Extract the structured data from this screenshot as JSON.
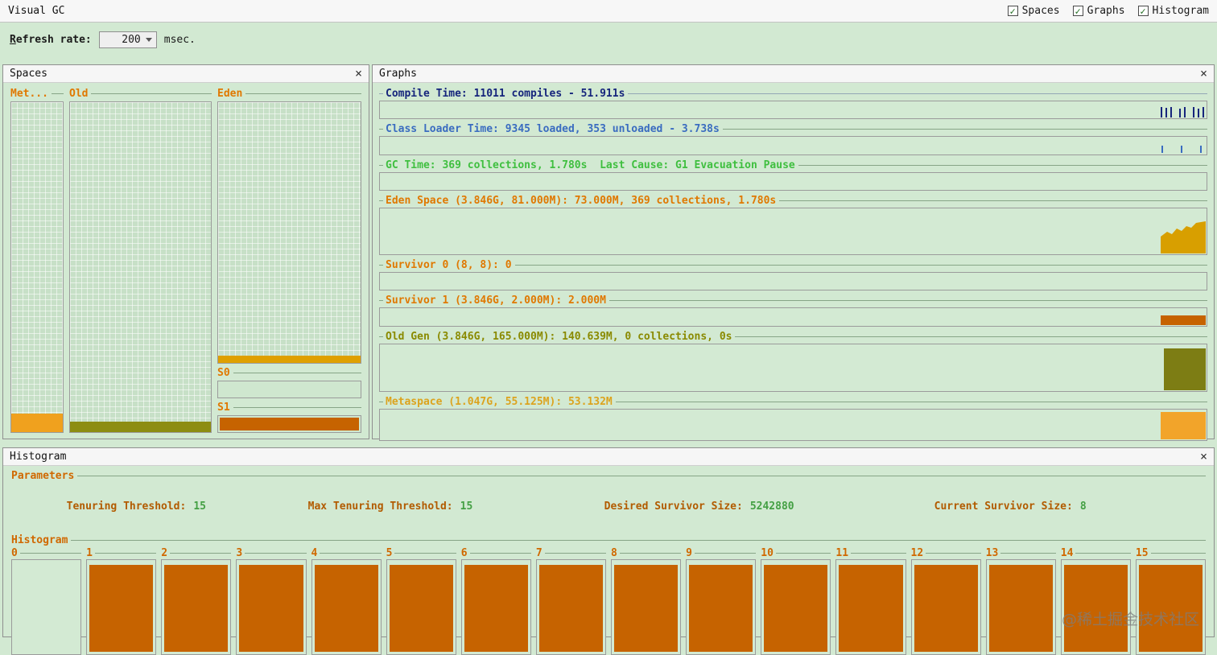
{
  "icons": {
    "close": "×",
    "check": "✓"
  },
  "topbar": {
    "title": "Visual GC",
    "checkboxes": [
      {
        "label": "Spaces",
        "checked": true
      },
      {
        "label": "Graphs",
        "checked": true
      },
      {
        "label": "Histogram",
        "checked": true
      }
    ]
  },
  "refresh": {
    "label": "Refresh rate:",
    "value": "200",
    "unit": "msec."
  },
  "spaces": {
    "title": "Spaces",
    "metaspace_label": "Met...",
    "old_label": "Old",
    "eden_label": "Eden",
    "s0_label": "S0",
    "s1_label": "S1"
  },
  "graphs": {
    "title": "Graphs",
    "rows": [
      {
        "id": "compile-time",
        "label": "Compile Time: 11011 compiles - 51.911s"
      },
      {
        "id": "class-loader",
        "label": "Class Loader Time: 9345 loaded, 353 unloaded - 3.738s"
      },
      {
        "id": "gc-time",
        "label": "GC Time: 369 collections, 1.780s  Last Cause: G1 Evacuation Pause"
      },
      {
        "id": "eden-space",
        "label": "Eden Space (3.846G, 81.000M): 73.000M, 369 collections, 1.780s"
      },
      {
        "id": "survivor-0",
        "label": "Survivor 0 (8, 8): 0"
      },
      {
        "id": "survivor-1",
        "label": "Survivor 1 (3.846G, 2.000M): 2.000M"
      },
      {
        "id": "old-gen",
        "label": "Old Gen (3.846G, 165.000M): 140.639M, 0 collections, 0s"
      },
      {
        "id": "metaspace",
        "label": "Metaspace (1.047G, 55.125M): 53.132M"
      }
    ]
  },
  "histogram": {
    "title": "Histogram",
    "parameters": {
      "group_label": "Parameters",
      "items": [
        {
          "label": "Tenuring Threshold:",
          "value": "15"
        },
        {
          "label": "Max Tenuring Threshold:",
          "value": "15"
        },
        {
          "label": "Desired Survivor Size:",
          "value": "5242880"
        },
        {
          "label": "Current Survivor Size:",
          "value": "8"
        }
      ]
    },
    "bars": {
      "group_label": "Histogram",
      "items": [
        {
          "label": "0",
          "filled": false
        },
        {
          "label": "1",
          "filled": true
        },
        {
          "label": "2",
          "filled": true
        },
        {
          "label": "3",
          "filled": true
        },
        {
          "label": "4",
          "filled": true
        },
        {
          "label": "5",
          "filled": true
        },
        {
          "label": "6",
          "filled": true
        },
        {
          "label": "7",
          "filled": true
        },
        {
          "label": "8",
          "filled": true
        },
        {
          "label": "9",
          "filled": true
        },
        {
          "label": "10",
          "filled": true
        },
        {
          "label": "11",
          "filled": true
        },
        {
          "label": "12",
          "filled": true
        },
        {
          "label": "13",
          "filled": true
        },
        {
          "label": "14",
          "filled": true
        },
        {
          "label": "15",
          "filled": true
        }
      ]
    }
  },
  "colors": {
    "background_green": "#d2e9d2",
    "compile_navy": "#16257c",
    "classloader_blue": "#3a6cc0",
    "gc_green": "#3fbf3f",
    "eden_orange": "#e07800",
    "oldgen_olive": "#8a8a00",
    "metaspace_amber": "#dca31e",
    "survivor_fill": "#c66300",
    "histogram_fill": "#c66300"
  },
  "watermark": "@稀土掘金技术社区"
}
